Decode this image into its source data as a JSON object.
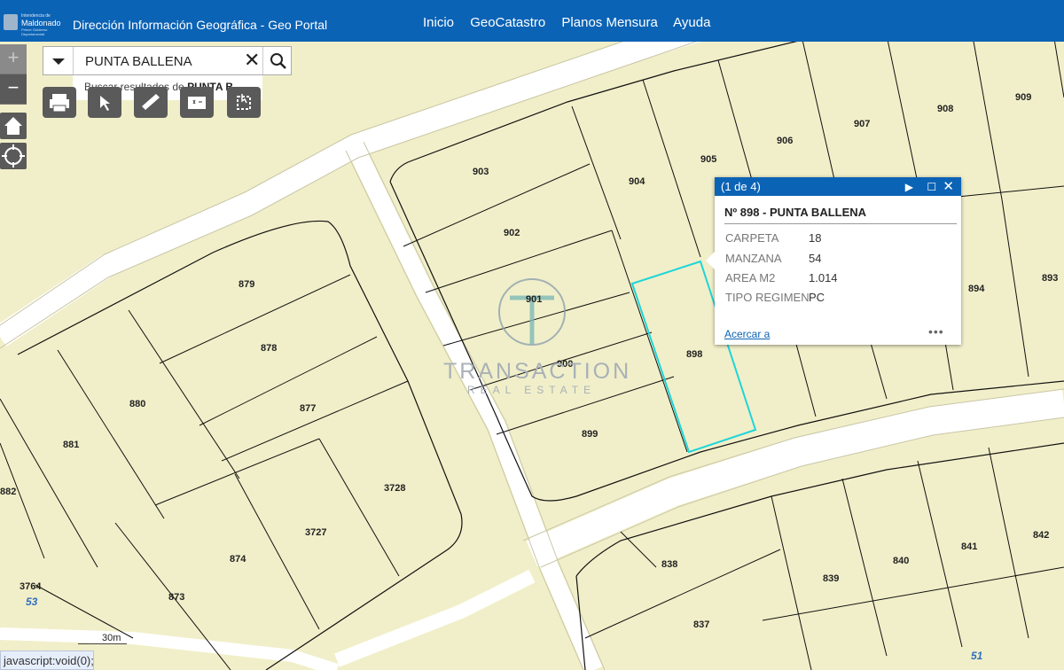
{
  "header": {
    "logo_lines": [
      "Intendencia de",
      "Maldonado",
      "Primer Gobierno Departamental"
    ],
    "title": "Dirección Información Geográfica -  Geo Portal",
    "nav": [
      "Inicio",
      "GeoCatastro",
      "Planos Mensura",
      "Ayuda"
    ]
  },
  "zoom": {
    "plus": "+",
    "minus": "−"
  },
  "search": {
    "value": "PUNTA BALLENA",
    "suggest_prefix": "Buscar resultados de ",
    "suggest_term": "PUNTA B…"
  },
  "tools": [
    "print-icon",
    "identify-icon",
    "measure-icon",
    "layers-icon",
    "select-icon"
  ],
  "popup": {
    "counter": "(1 de 4)",
    "title": "Nº 898 - PUNTA BALLENA",
    "fields": [
      {
        "label": "CARPETA",
        "value": "18"
      },
      {
        "label": "MANZANA",
        "value": "54"
      },
      {
        "label": "AREA M2",
        "value": "1.014"
      },
      {
        "label": "TIPO REGIMEN",
        "value": "PC"
      }
    ],
    "zoom_link": "Acercar a",
    "more": "•••"
  },
  "parcels": [
    "909",
    "908",
    "907",
    "906",
    "905",
    "904",
    "903",
    "902",
    "901",
    "900",
    "899",
    "898",
    "894",
    "893",
    "879",
    "878",
    "877",
    "880",
    "881",
    "882",
    "3728",
    "3727",
    "874",
    "873",
    "3764",
    "838",
    "839",
    "840",
    "841",
    "842",
    "837"
  ],
  "block_labels": [
    "53",
    "51"
  ],
  "watermark": {
    "letter": "T",
    "name": "TRANSACTION",
    "sub": "REAL ESTATE"
  },
  "scale_text": "30m",
  "status_text": "javascript:void(0);",
  "colors": {
    "header": "#0b63b5",
    "land": "#f1efc9",
    "road": "#ffffff",
    "highlight": "#1fd5d9"
  }
}
